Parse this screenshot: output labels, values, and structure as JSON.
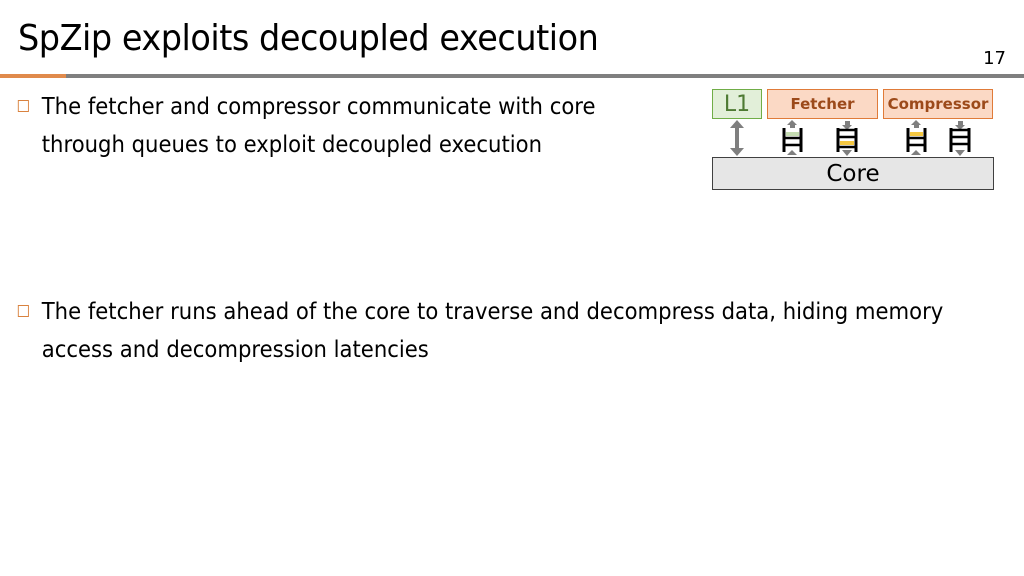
{
  "slide": {
    "title": "SpZip exploits decoupled execution",
    "number": "17"
  },
  "bullets": [
    {
      "text": "The fetcher and compressor communicate with core through queues to exploit decoupled execution"
    },
    {
      "text": "The fetcher runs ahead of the core to traverse and decompress data, hiding memory access and decompression latencies"
    }
  ],
  "diagram": {
    "l1_label": "L1",
    "fetcher_label": "Fetcher",
    "compressor_label": "Compressor",
    "core_label": "Core",
    "colors": {
      "l1_fill": "#e2efd9",
      "l1_border": "#70ad47",
      "unit_fill": "#fbd9c5",
      "unit_border": "#e07b39",
      "core_fill": "#e6e6e6",
      "queue_green": "#c5dcb2",
      "queue_yellow": "#f5c842",
      "arrow": "#7f7f7f"
    }
  }
}
